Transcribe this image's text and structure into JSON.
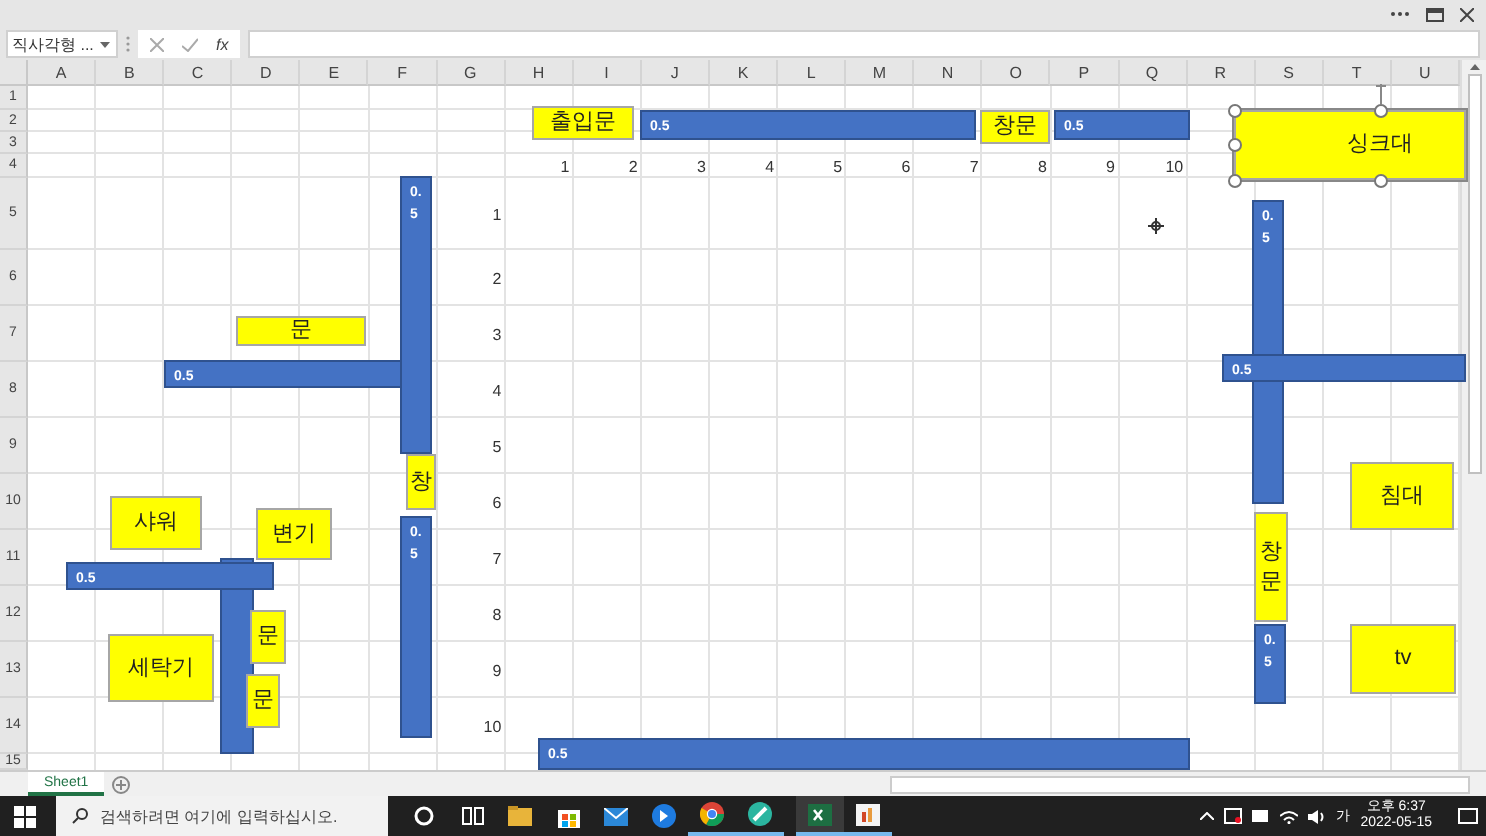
{
  "formula_bar": {
    "name_box": "직사각형 ...",
    "fx": "fx"
  },
  "columns": [
    "A",
    "B",
    "C",
    "D",
    "E",
    "F",
    "G",
    "H",
    "I",
    "J",
    "K",
    "L",
    "M",
    "N",
    "O",
    "P",
    "Q",
    "R",
    "S",
    "T",
    "U"
  ],
  "rows": [
    "1",
    "2",
    "3",
    "4",
    "5",
    "6",
    "7",
    "8",
    "9",
    "10",
    "11",
    "12",
    "13",
    "14",
    "15"
  ],
  "top_ruler": [
    "1",
    "2",
    "3",
    "4",
    "5",
    "6",
    "7",
    "8",
    "9",
    "10"
  ],
  "side_ruler": [
    "1",
    "2",
    "3",
    "4",
    "5",
    "6",
    "7",
    "8",
    "9",
    "10"
  ],
  "shapes": [
    {
      "kind": "label",
      "text": "출입문",
      "selected": false
    },
    {
      "kind": "wall",
      "text": "0.5",
      "selected": false
    },
    {
      "kind": "label",
      "text": "창문",
      "selected": false
    },
    {
      "kind": "wall",
      "text": "0.5",
      "selected": false
    },
    {
      "kind": "label",
      "text": "싱크대",
      "selected": true
    },
    {
      "kind": "wall",
      "text": "0.5",
      "selected": false
    },
    {
      "kind": "label",
      "text": "문",
      "selected": false
    },
    {
      "kind": "wall",
      "text": "0.5",
      "selected": false
    },
    {
      "kind": "label",
      "text": "창",
      "selected": false
    },
    {
      "kind": "wall",
      "text": "0.5",
      "selected": false
    },
    {
      "kind": "label",
      "text": "샤워",
      "selected": false
    },
    {
      "kind": "label",
      "text": "변기",
      "selected": false
    },
    {
      "kind": "wall",
      "selected": false
    },
    {
      "kind": "wall",
      "text": "0.5",
      "selected": false
    },
    {
      "kind": "label",
      "text": "문",
      "selected": false
    },
    {
      "kind": "label",
      "text": "세탁기",
      "selected": false
    },
    {
      "kind": "label",
      "text": "문",
      "selected": false
    },
    {
      "kind": "wall",
      "text": "0.5",
      "selected": false
    },
    {
      "kind": "wall",
      "text": "0.5",
      "selected": false
    },
    {
      "kind": "wall",
      "text": "0.5",
      "selected": false
    },
    {
      "kind": "label",
      "text": "창문",
      "selected": false
    },
    {
      "kind": "wall",
      "text": "0.5",
      "selected": false
    },
    {
      "kind": "label",
      "text": "침대",
      "selected": false
    },
    {
      "kind": "label",
      "text": "tv",
      "selected": false
    }
  ],
  "sheet_tabs": [
    {
      "label": "Sheet1",
      "selected": true
    }
  ],
  "taskbar": {
    "search_placeholder": "검색하려면 여기에 입력하십시오.",
    "input_method": "가",
    "time": "오후 6:37",
    "date": "2022-05-15"
  }
}
